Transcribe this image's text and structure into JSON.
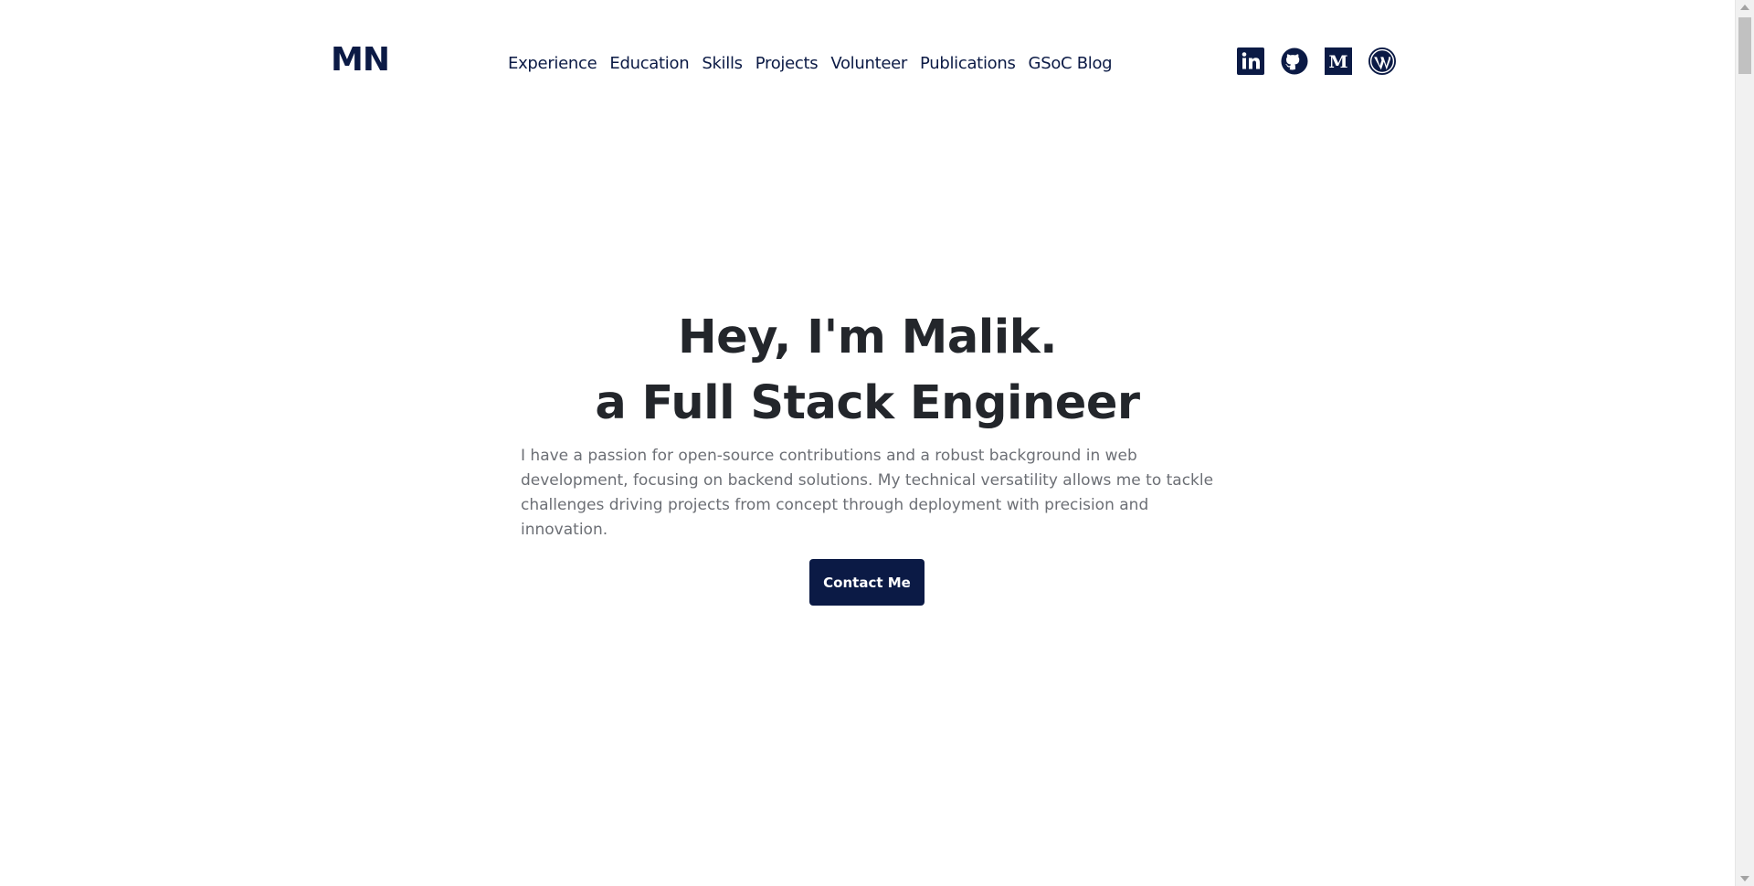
{
  "header": {
    "logo": "MN",
    "nav": [
      {
        "label": "Experience"
      },
      {
        "label": "Education"
      },
      {
        "label": "Skills"
      },
      {
        "label": "Projects"
      },
      {
        "label": "Volunteer"
      },
      {
        "label": "Publications"
      },
      {
        "label": "GSoC Blog"
      }
    ],
    "socials": [
      {
        "icon": "linkedin-icon"
      },
      {
        "icon": "github-icon"
      },
      {
        "icon": "medium-icon"
      },
      {
        "icon": "wordpress-icon"
      }
    ]
  },
  "hero": {
    "title_line1": "Hey, I'm Malik.",
    "title_line2": "a Full Stack Engineer",
    "description": "I have a passion for open-source contributions and a robust background in web development, focusing on backend solutions. My technical versatility allows me to tackle challenges driving projects from concept through deployment with precision and innovation.",
    "cta_label": "Contact Me"
  },
  "colors": {
    "brand": "#0b1a45",
    "heading": "#23262b",
    "body_text": "#6c6f75",
    "background": "#ffffff"
  }
}
